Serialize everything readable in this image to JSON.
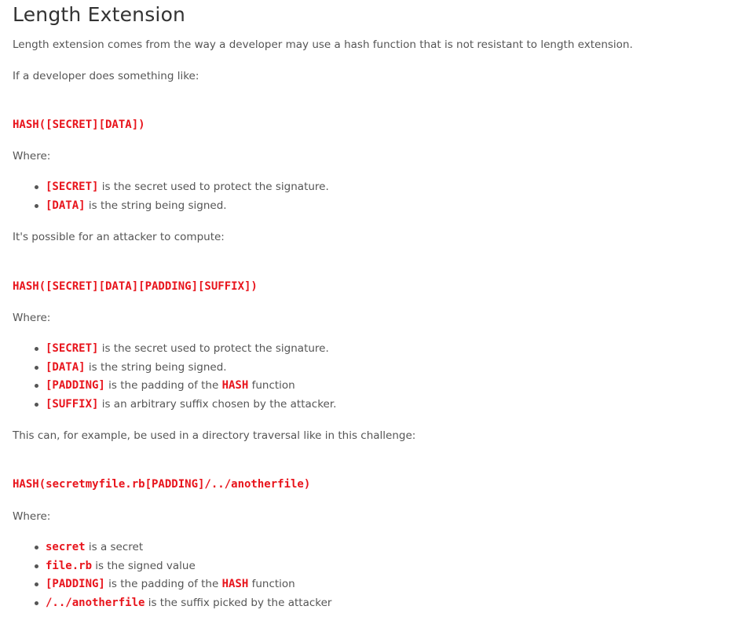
{
  "title": "Length Extension",
  "intro": "Length extension comes from the way a developer may use a hash function that is not resistant to length extension.",
  "if_dev": "If a developer does something like:",
  "code1": "HASH([SECRET][DATA])",
  "where1": "Where:",
  "list1": [
    {
      "code": "[SECRET]",
      "text": " is the secret used to protect the signature."
    },
    {
      "code": "[DATA]",
      "text": " is the string being signed."
    }
  ],
  "possible": "It's possible for an attacker to compute:",
  "code2": "HASH([SECRET][DATA][PADDING][SUFFIX])",
  "where2": "Where:",
  "list2": [
    {
      "code": "[SECRET]",
      "text": " is the secret used to protect the signature."
    },
    {
      "code": "[DATA]",
      "text": " is the string being signed."
    },
    {
      "code": "[PADDING]",
      "text": " is the padding of the ",
      "code_b": "HASH",
      "text_b": " function"
    },
    {
      "code": "[SUFFIX]",
      "text": " is an arbitrary suffix chosen by the attacker."
    }
  ],
  "example": "This can, for example, be used in a directory traversal like in this challenge:",
  "code3": "HASH(secretmyfile.rb[PADDING]/../anotherfile)",
  "where3": "Where:",
  "list3": [
    {
      "code": "secret",
      "text": " is a secret"
    },
    {
      "code": "file.rb",
      "text": " is the signed value"
    },
    {
      "code": "[PADDING]",
      "text": " is the padding of the ",
      "code_b": "HASH",
      "text_b": " function"
    },
    {
      "code": "/../anotherfile",
      "text": " is the suffix picked by the attacker"
    }
  ],
  "colors": {
    "code_red": "#e8141c",
    "body_text": "#555555",
    "heading": "#333333"
  }
}
